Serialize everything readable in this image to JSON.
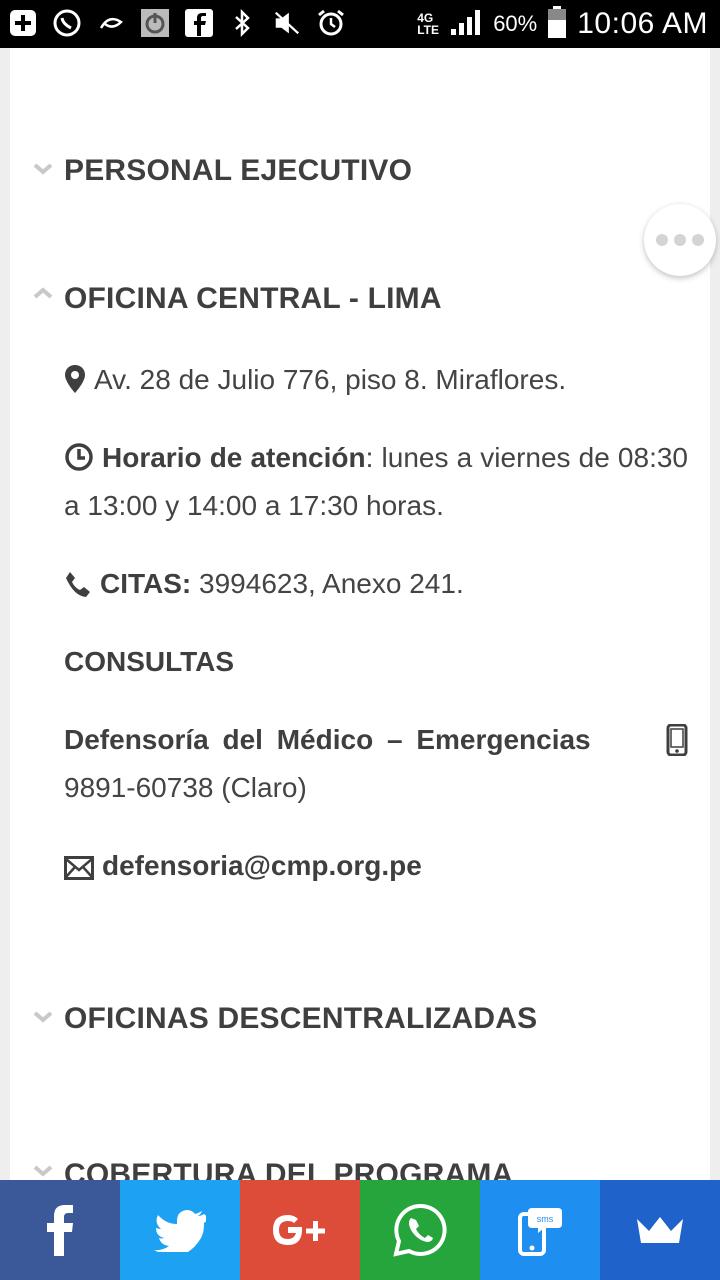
{
  "statusbar": {
    "battery_text": "60%",
    "network_text": "4G LTE",
    "time": "10:06 AM"
  },
  "sections": {
    "personal": {
      "title": "PERSONAL EJECUTIVO"
    },
    "central": {
      "title": "OFICINA CENTRAL - LIMA",
      "address": "Av. 28 de Julio 776, piso 8. Miraflores.",
      "hours_label": "Horario de atención",
      "hours_text": ": lunes a viernes de 08:30 a 13:00  y  14:00 a 17:30 horas.",
      "citas_label": "CITAS:",
      "citas_text": " 3994623, Anexo 241.",
      "consultas": "CONSULTAS",
      "defensoria_label": "Defensoría del Médico – Emergencias",
      "defensoria_phone": "9891-60738 (Claro)",
      "email": "defensoria@cmp.org.pe"
    },
    "descentralizadas": {
      "title": "OFICINAS DESCENTRALIZADAS"
    },
    "cobertura": {
      "title": "COBERTURA DEL PROGRAMA"
    }
  },
  "share": {
    "colors": {
      "facebook": "#3b5998",
      "twitter": "#1da1f2",
      "googleplus": "#dd4b39",
      "whatsapp": "#25a53c",
      "sms": "#1e8ff0",
      "crown": "#1f62c9"
    }
  }
}
